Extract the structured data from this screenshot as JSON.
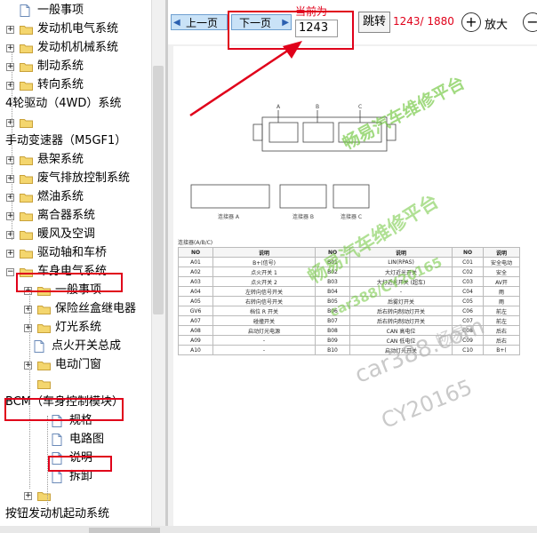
{
  "tree": {
    "items": [
      {
        "label": "一般事项",
        "indent": 1,
        "expander": false,
        "icon": "doc"
      },
      {
        "label": "发动机电气系统",
        "indent": 1,
        "expander": true,
        "icon": "folder"
      },
      {
        "label": "发动机机械系统",
        "indent": 1,
        "expander": true,
        "icon": "folder"
      },
      {
        "label": "制动系统",
        "indent": 1,
        "expander": true,
        "icon": "folder"
      },
      {
        "label": "转向系统",
        "indent": 1,
        "expander": true,
        "icon": "folder"
      },
      {
        "label": "4轮驱动（4WD）系统",
        "indent": 0,
        "expander": false,
        "icon": "none"
      },
      {
        "label": "",
        "indent": 1,
        "expander": true,
        "icon": "folder"
      },
      {
        "label": "手动变速器（M5GF1）",
        "indent": 0,
        "expander": false,
        "icon": "none"
      },
      {
        "label": "悬架系统",
        "indent": 1,
        "expander": true,
        "icon": "folder"
      },
      {
        "label": "废气排放控制系统",
        "indent": 1,
        "expander": true,
        "icon": "folder"
      },
      {
        "label": "燃油系统",
        "indent": 1,
        "expander": true,
        "icon": "folder"
      },
      {
        "label": "离合器系统",
        "indent": 1,
        "expander": true,
        "icon": "folder"
      },
      {
        "label": "暖风及空调",
        "indent": 1,
        "expander": true,
        "icon": "folder"
      },
      {
        "label": "驱动轴和车桥",
        "indent": 1,
        "expander": true,
        "icon": "folder"
      },
      {
        "label": "车身电气系统",
        "indent": 1,
        "expander": "open",
        "icon": "folder"
      },
      {
        "label": "一般事项",
        "indent": 2,
        "expander": true,
        "icon": "folder"
      },
      {
        "label": "保险丝盒继电器",
        "indent": 2,
        "expander": true,
        "icon": "folder"
      },
      {
        "label": "灯光系统",
        "indent": 2,
        "expander": true,
        "icon": "folder"
      },
      {
        "label": "点火开关总成",
        "indent": 2,
        "expander": false,
        "icon": "doc"
      },
      {
        "label": "电动门窗",
        "indent": 2,
        "expander": true,
        "icon": "folder"
      },
      {
        "label": "",
        "indent": 2,
        "expander": false,
        "icon": "folder"
      },
      {
        "label": "BCM（车身控制模块）",
        "indent": 0,
        "expander": false,
        "icon": "none"
      },
      {
        "label": "规格",
        "indent": 3,
        "expander": false,
        "icon": "doc"
      },
      {
        "label": "电路图",
        "indent": 3,
        "expander": false,
        "icon": "doc"
      },
      {
        "label": "说明",
        "indent": 3,
        "expander": false,
        "icon": "doc"
      },
      {
        "label": "拆卸",
        "indent": 3,
        "expander": false,
        "icon": "doc"
      },
      {
        "label": "",
        "indent": 2,
        "expander": true,
        "icon": "folder"
      },
      {
        "label": "按钮发动机起动系统",
        "indent": 0,
        "expander": false,
        "icon": "none"
      }
    ]
  },
  "toolbar": {
    "prev_label": "上一页",
    "next_label": "下一页",
    "current_label": "当前为",
    "page_value": "1243",
    "jump_label": "跳转",
    "page_status": "1243/ 1880",
    "zoom_in_label": "放大"
  },
  "document": {
    "diagram_labels": [
      "A",
      "B",
      "C"
    ],
    "connector_captions": [
      "连接器 A",
      "连接器 B",
      "连接器 C"
    ],
    "table_title": "连接器(A/B/C)",
    "table_header": [
      "NO",
      "说明",
      "NO",
      "说明",
      "NO",
      "说明"
    ],
    "rows": [
      [
        "A01",
        "B+(信号)",
        "B01",
        "LIN(RPAS)",
        "C01",
        "安全电动"
      ],
      [
        "A02",
        "点火开关 1",
        "B02",
        "大灯近光开关",
        "C02",
        "安全"
      ],
      [
        "A03",
        "点火开关 2",
        "B03",
        "大灯近光开关 (超车)",
        "C03",
        "AV开"
      ],
      [
        "A04",
        "左转向信号开关",
        "B04",
        "-",
        "C04",
        "雨"
      ],
      [
        "A05",
        "右转向信号开关",
        "B05",
        "后雾灯开关",
        "C05",
        "雨"
      ],
      [
        "GV6",
        "档位 R 开关",
        "B06",
        "后右转向制动灯开关",
        "C06",
        "前左"
      ],
      [
        "A07",
        "碰撞开关",
        "B07",
        "后右转向制动灯开关",
        "C07",
        "前左"
      ],
      [
        "A08",
        "启动灯光电源",
        "B08",
        "CAN 高电位",
        "C08",
        "后右"
      ],
      [
        "A09",
        "-",
        "B09",
        "CAN 低电位",
        "C09",
        "后右"
      ],
      [
        "A10",
        "-",
        "B10",
        "启动灯光开关",
        "C10",
        "B+("
      ]
    ]
  },
  "watermarks": [
    "畅易汽车维修平台",
    "畅易汽车维修平台",
    "car388.com",
    "car388/CY20165",
    "CY20165",
    "畅易"
  ],
  "colors": {
    "highlight": "#e0001a",
    "button": "#c9e2f7",
    "watermark_green": "#6fc63c"
  }
}
